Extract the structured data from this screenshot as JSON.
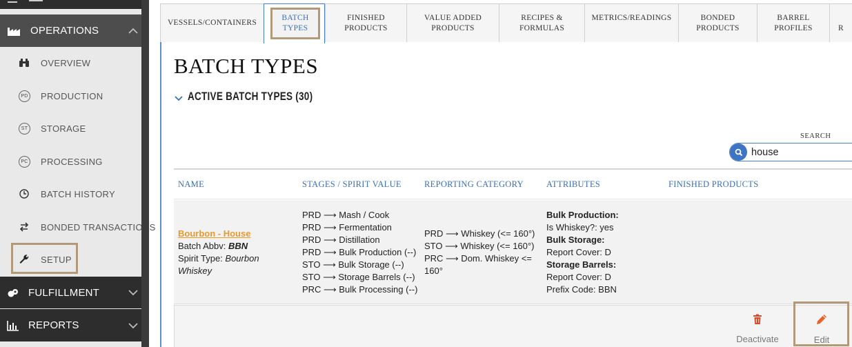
{
  "sidebar": {
    "operations_label": "OPERATIONS",
    "items": [
      {
        "label": "OVERVIEW",
        "icon": "binoculars-icon"
      },
      {
        "label": "PRODUCTION",
        "icon": "pd-circle-icon",
        "badge": "PD"
      },
      {
        "label": "STORAGE",
        "icon": "st-circle-icon",
        "badge": "ST"
      },
      {
        "label": "PROCESSING",
        "icon": "pc-circle-icon",
        "badge": "PC"
      },
      {
        "label": "BATCH HISTORY",
        "icon": "clock-icon"
      },
      {
        "label": "BONDED TRANSACTIONS",
        "icon": "swap-arrows-icon"
      },
      {
        "label": "SETUP",
        "icon": "wrench-icon"
      }
    ],
    "fulfillment_label": "FULFILLMENT",
    "reports_label": "REPORTS"
  },
  "tabs": [
    {
      "label": "VESSELS/CONTAINERS"
    },
    {
      "label": "BATCH\nTYPES",
      "active": true
    },
    {
      "label": "FINISHED\nPRODUCTS"
    },
    {
      "label": "VALUE ADDED\nPRODUCTS"
    },
    {
      "label": "RECIPES &\nFORMULAS"
    },
    {
      "label": "METRICS/READINGS"
    },
    {
      "label": "BONDED\nPRODUCTS"
    },
    {
      "label": "BARREL\nPROFILES"
    },
    {
      "label": "R"
    }
  ],
  "page": {
    "title": "BATCH TYPES",
    "section_title": "ACTIVE BATCH TYPES (30)"
  },
  "search": {
    "label": "SEARCH",
    "value": "house"
  },
  "table": {
    "headers": [
      "NAME",
      "STAGES / SPIRIT VALUE",
      "REPORTING CATEGORY",
      "ATTRIBUTES",
      "FINISHED PRODUCTS"
    ],
    "row": {
      "name": "Bourbon - House",
      "abbv_label": "Batch Abbv: ",
      "abbv_value": "BBN",
      "spirit_label": "Spirit Type: ",
      "spirit_value_1": "Bourbon",
      "spirit_value_2": "Whiskey",
      "stages": [
        "PRD ⟶ Mash / Cook",
        "PRD ⟶ Fermentation",
        "PRD ⟶ Distillation",
        "PRD ⟶ Bulk Production (--)",
        "STO ⟶ Bulk Storage (--)",
        "STO ⟶ Storage Barrels (--)",
        "PRC ⟶ Bulk Processing (--)"
      ],
      "reporting": [
        "PRD ⟶ Whiskey (<= 160°)",
        "STO ⟶ Whiskey (<= 160°)",
        "PRC ⟶ Dom. Whiskey <=",
        "160°"
      ],
      "attributes": {
        "bulk_production_heading": "Bulk Production:",
        "is_whiskey": "Is Whiskey?: yes",
        "bulk_storage_heading": "Bulk Storage:",
        "bulk_storage_cover": "Report Cover: D",
        "storage_barrels_heading": "Storage Barrels:",
        "storage_barrels_cover": "Report Cover: D",
        "prefix_code": "Prefix Code: BBN"
      }
    }
  },
  "actions": {
    "deactivate_label": "Deactivate",
    "edit_label": "Edit"
  },
  "colors": {
    "accent_blue": "#3b6fb6",
    "link_orange": "#e69a2e",
    "highlight_box": "#b09a7a",
    "trash_red": "#d9482b",
    "edit_orange": "#e8632a"
  }
}
